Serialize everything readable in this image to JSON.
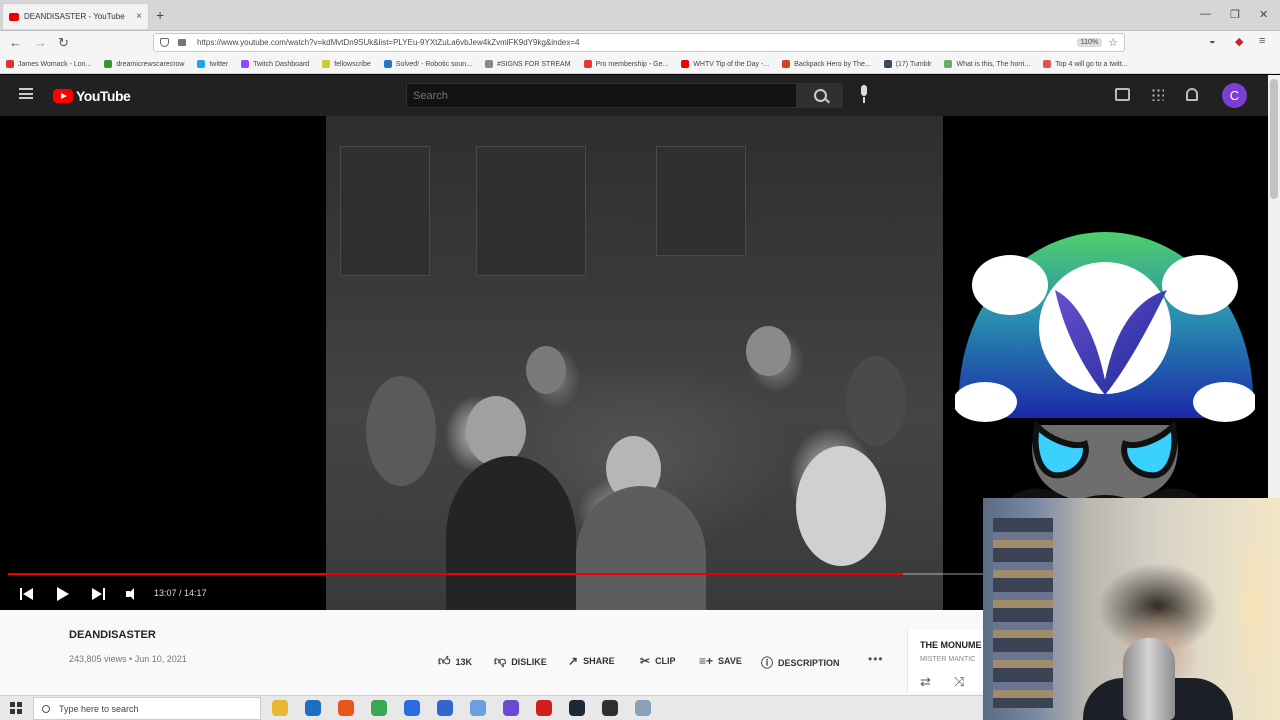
{
  "browser": {
    "tab_title": "DEANDISASTER - YouTube",
    "url": "https://www.youtube.com/watch?v=kdMvtDn9SUk&list=PLYEu-9YXtZuLa6vbJew4kZvmlFK9dY9kg&index=4",
    "zoom": "110%",
    "bookmarks": [
      {
        "label": "James Womack - Lon...",
        "color": "#d33"
      },
      {
        "label": "dreamicrewscarecrow",
        "color": "#393"
      },
      {
        "label": "twitter",
        "color": "#1da1f2"
      },
      {
        "label": "Twitch Dashboard",
        "color": "#9146ff"
      },
      {
        "label": "fellowscribe",
        "color": "#cc3"
      },
      {
        "label": "Solved! - Robotic soun...",
        "color": "#27c"
      },
      {
        "label": "#SIGNS FOR STREAM",
        "color": "#888"
      },
      {
        "label": "Pro membership - Ge...",
        "color": "#e33"
      },
      {
        "label": "WHTV Tip of the Day -...",
        "color": "#e00"
      },
      {
        "label": "Backpack Hero by The...",
        "color": "#c42"
      },
      {
        "label": "(17) Tumblr",
        "color": "#36465d"
      },
      {
        "label": "What is this, The horri...",
        "color": "#6a6"
      },
      {
        "label": "Top 4 will go to a twitt...",
        "color": "#d55"
      }
    ]
  },
  "youtube": {
    "logo_text": "YouTube",
    "search_placeholder": "Search",
    "avatar_letter": "C"
  },
  "player": {
    "current_time": "13:07",
    "duration": "14:17",
    "progress": 0.918
  },
  "video": {
    "title": "DEANDISASTER",
    "meta": "243,805 views • Jun 10, 2021",
    "actions": {
      "like": "13K",
      "dislike": "DISLIKE",
      "share": "SHARE",
      "clip": "CLIP",
      "save": "SAVE",
      "description": "DESCRIPTION"
    }
  },
  "playlist_card": {
    "title": "THE MONUME",
    "subtitle": "MISTER MANTIC"
  },
  "taskbar": {
    "search_placeholder": "Type here to search",
    "apps": [
      {
        "icon": "file-explorer-icon",
        "color": "#e8b730"
      },
      {
        "icon": "mail-icon",
        "color": "#1d6fc4"
      },
      {
        "icon": "firefox-icon",
        "color": "#e8561d"
      },
      {
        "icon": "chrome-icon",
        "color": "#3aa757"
      },
      {
        "icon": "app-k-icon",
        "color": "#2b6de0"
      },
      {
        "icon": "headset-icon",
        "color": "#3366cc"
      },
      {
        "icon": "chat-icon",
        "color": "#6aa0e0"
      },
      {
        "icon": "refresh-app-icon",
        "color": "#6a4bd0"
      },
      {
        "icon": "record-app-icon",
        "color": "#d21e1e"
      },
      {
        "icon": "steam-icon",
        "color": "#1b2838"
      },
      {
        "icon": "obs-icon",
        "color": "#302e31"
      },
      {
        "icon": "monitor-icon",
        "color": "#8aa0b8"
      }
    ]
  }
}
